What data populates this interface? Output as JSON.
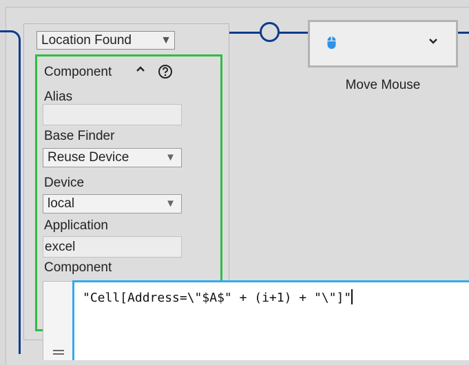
{
  "flow": {
    "action_label": "Move Mouse",
    "action_icon": "mouse-icon",
    "dropdown_icon": "chevron-down-icon",
    "line_color": "#0d3b8c"
  },
  "panel": {
    "location_select": "Location Found",
    "section_title": "Component",
    "alias_label": "Alias",
    "alias_value": "",
    "base_finder_label": "Base Finder",
    "base_finder_value": "Reuse Device",
    "device_label": "Device",
    "device_value": "local",
    "application_label": "Application",
    "application_value": "excel",
    "component_label": "Component",
    "highlight_color": "#2ebd45"
  },
  "editor": {
    "text": "\"Cell[Address=\\\"$A$\" + (i+1) + \"\\\"]\"",
    "border_color": "#33a9f0"
  }
}
